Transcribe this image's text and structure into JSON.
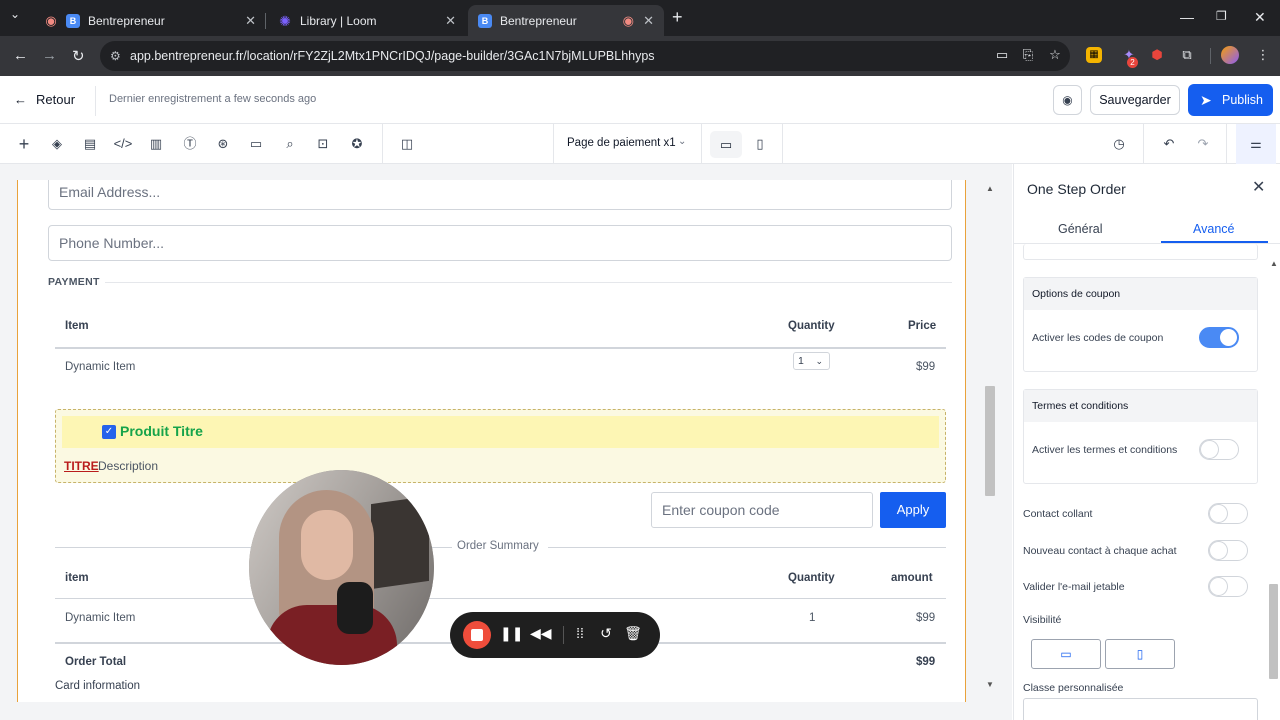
{
  "browser": {
    "tabs": [
      {
        "title": "Bentrepreneur",
        "favicon": "B",
        "active": false
      },
      {
        "title": "Library | Loom",
        "favicon": "loom-icon",
        "active": false
      },
      {
        "title": "Bentrepreneur",
        "favicon": "B",
        "active": true
      }
    ],
    "url": "app.bentrepreneur.fr/location/rFY2ZjL2Mtx1PNCrIDQJ/page-builder/3GAc1N7bjMLUPBLhhyps",
    "extension_badge": "2"
  },
  "header": {
    "back_label": "Retour",
    "saved_status": "Dernier enregistrement a few seconds ago",
    "save_label": "Sauvegarder",
    "publish_label": "Publish"
  },
  "toolbar": {
    "page_select": "Page de paiement x1"
  },
  "form": {
    "email_placeholder": "Email Address...",
    "phone_placeholder": "Phone Number...",
    "payment_label": "PAYMENT",
    "items_table": {
      "headers": [
        "Item",
        "Quantity",
        "Price"
      ],
      "rows": [
        {
          "item": "Dynamic Item",
          "quantity": "1",
          "price": "$99"
        }
      ]
    },
    "bump": {
      "title": "Produit Titre",
      "desc_emphasis": "TITRE ",
      "desc": "Description"
    },
    "coupon_placeholder": "Enter coupon code",
    "apply_label": "Apply",
    "summary_label": "Order Summary",
    "summary_table": {
      "headers": [
        "item",
        "Quantity",
        "amount"
      ],
      "rows": [
        {
          "item": "Dynamic Item",
          "quantity": "1",
          "amount": "$99"
        }
      ],
      "total_label": "Order Total",
      "total_value": "$99"
    },
    "card_info_label": "Card information"
  },
  "panel": {
    "title": "One Step Order",
    "tabs": [
      "Général",
      "Avancé"
    ],
    "active_tab": "Avancé",
    "coupon_section": {
      "title": "Options de coupon",
      "row_label": "Activer les codes de coupon",
      "enabled": true
    },
    "terms_section": {
      "title": "Termes et conditions",
      "row_label": "Activer les termes et conditions",
      "enabled": false
    },
    "rows": [
      {
        "label": "Contact collant",
        "enabled": false
      },
      {
        "label": "Nouveau contact à chaque achat",
        "enabled": false
      },
      {
        "label": "Valider l'e-mail jetable",
        "enabled": false
      }
    ],
    "visibility_label": "Visibilité",
    "custom_class_label": "Classe personnalisée"
  },
  "colors": {
    "primary": "#155eef",
    "bump_title": "#16a34a",
    "bump_emphasis": "#b91c1c",
    "record": "#ef4d3b"
  }
}
